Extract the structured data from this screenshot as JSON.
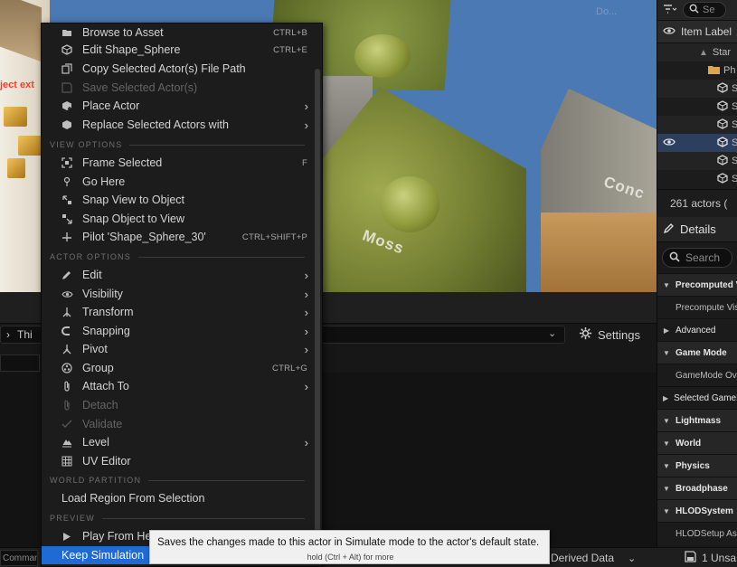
{
  "viewport": {
    "decal_moss": "Moss",
    "decal_concrete": "Conc",
    "red_text": "ject ext",
    "corner_hint": "Do..."
  },
  "outliner": {
    "search_text": "Se",
    "header_label": "Item Label",
    "rows": [
      "Star",
      "Ph",
      "S",
      "S",
      "S",
      "S",
      "S",
      "S"
    ],
    "actor_count": "261 actors ("
  },
  "details": {
    "tab_label": "Details",
    "search_placeholder": "Search",
    "rows": [
      {
        "kind": "cat",
        "label": "Precomputed V"
      },
      {
        "kind": "prop",
        "label": "Precompute Vis"
      },
      {
        "kind": "cat2",
        "label": "Advanced"
      },
      {
        "kind": "cat",
        "label": "Game Mode"
      },
      {
        "kind": "prop",
        "label": "GameMode Ove"
      },
      {
        "kind": "cat2",
        "label": "Selected GameM"
      },
      {
        "kind": "cat",
        "label": "Lightmass"
      },
      {
        "kind": "cat",
        "label": "World"
      },
      {
        "kind": "cat",
        "label": "Physics"
      },
      {
        "kind": "cat",
        "label": "Broadphase"
      },
      {
        "kind": "cat",
        "label": "HLODSystem"
      },
      {
        "kind": "prop",
        "label": "HLODSetup Ass"
      }
    ]
  },
  "lower": {
    "path_text": "Thi",
    "settings_label": "Settings"
  },
  "status": {
    "cmd_placeholder": "Comman",
    "derived": "Derived Data",
    "unsaved": "1 Unsa"
  },
  "menu": {
    "items": {
      "browse": {
        "label": "Browse to Asset",
        "shortcut": "CTRL+B"
      },
      "edit_shape": {
        "label": "Edit Shape_Sphere",
        "shortcut": "CTRL+E"
      },
      "copy_path": {
        "label": "Copy Selected Actor(s) File Path"
      },
      "save_actors": {
        "label": "Save Selected Actor(s)"
      },
      "place_actor": {
        "label": "Place Actor"
      },
      "replace_actors": {
        "label": "Replace Selected Actors with"
      },
      "frame_selected": {
        "label": "Frame Selected",
        "shortcut": "F"
      },
      "go_here": {
        "label": "Go Here"
      },
      "snap_view": {
        "label": "Snap View to Object"
      },
      "snap_object": {
        "label": "Snap Object to View"
      },
      "pilot": {
        "label": "Pilot 'Shape_Sphere_30'",
        "shortcut": "CTRL+SHIFT+P"
      },
      "edit": {
        "label": "Edit"
      },
      "visibility": {
        "label": "Visibility"
      },
      "transform": {
        "label": "Transform"
      },
      "snapping": {
        "label": "Snapping"
      },
      "pivot": {
        "label": "Pivot"
      },
      "group": {
        "label": "Group",
        "shortcut": "CTRL+G"
      },
      "attach": {
        "label": "Attach To"
      },
      "detach": {
        "label": "Detach"
      },
      "validate": {
        "label": "Validate"
      },
      "level": {
        "label": "Level"
      },
      "uv_editor": {
        "label": "UV Editor"
      },
      "load_region": {
        "label": "Load Region From Selection"
      },
      "play_from_here": {
        "label": "Play From He"
      },
      "keep_simulation": {
        "label": "Keep Simulation"
      }
    },
    "sections": {
      "view": "VIEW OPTIONS",
      "actor": "ACTOR OPTIONS",
      "world": "WORLD PARTITION",
      "preview": "PREVIEW"
    }
  },
  "tooltip": {
    "text": "Saves the changes made to this actor in Simulate mode to the actor's default state.",
    "hint": "hold (Ctrl + Alt) for more"
  },
  "colors": {
    "selection": "#1f6ad4",
    "menu_bg": "#1c1c1c",
    "sky": "#4b79b3"
  }
}
